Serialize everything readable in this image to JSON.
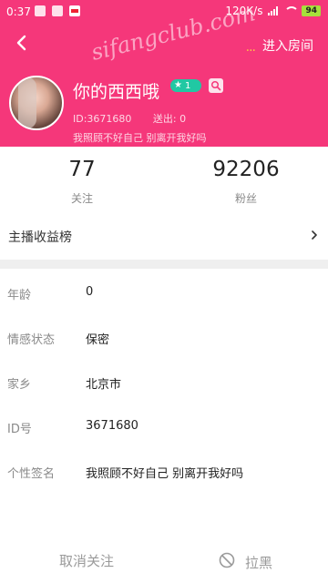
{
  "status_bar": {
    "time": "0:37",
    "net_speed": "120K/s",
    "battery": "94"
  },
  "header": {
    "enter_room_label": "进入房间",
    "enter_room_dots": "...",
    "watermark": "sifangclub.com",
    "back_icon": "chevron-left-icon"
  },
  "profile": {
    "username": "你的西西哦",
    "level": "1",
    "uid_line": "ID:3671680",
    "sent_line": "送出: 0",
    "signature": "我照顾不好自己 别离开我好吗"
  },
  "stats": {
    "following_count": "77",
    "following_label": "关注",
    "fans_count": "92206",
    "fans_label": "粉丝"
  },
  "earnings": {
    "label": "主播收益榜"
  },
  "info": [
    {
      "key": "年龄",
      "value": "0"
    },
    {
      "key": "情感状态",
      "value": "保密"
    },
    {
      "key": "家乡",
      "value": "北京市"
    },
    {
      "key": "ID号",
      "value": "3671680"
    },
    {
      "key": "个性签名",
      "value": "我照顾不好自己 别离开我好吗"
    }
  ],
  "actions": {
    "unfollow_label": "取消关注",
    "block_label": "拉黑"
  },
  "colors": {
    "accent": "#f5377a",
    "badge": "#21c8a3"
  }
}
